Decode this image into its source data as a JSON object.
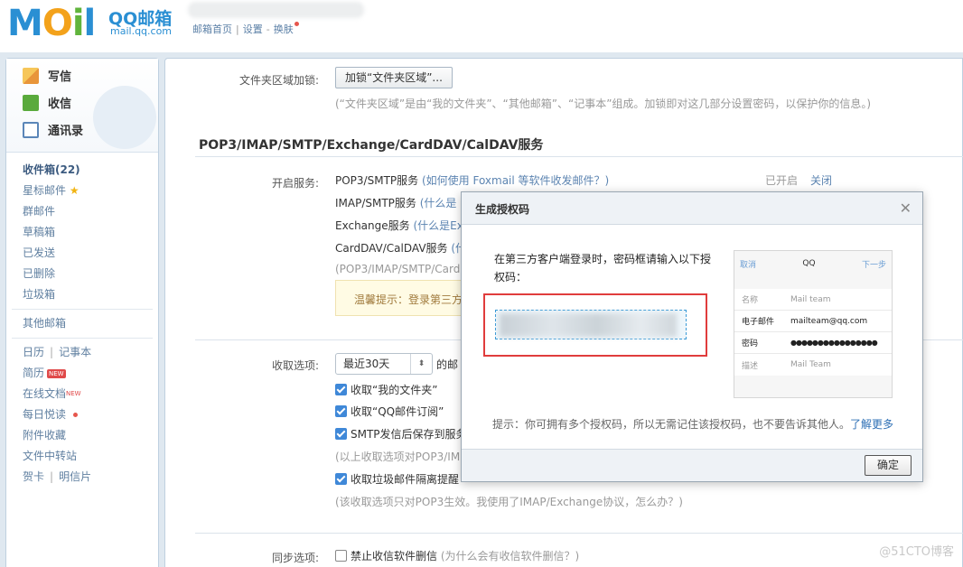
{
  "header": {
    "logo_text": "MOIL",
    "logo_name": "QQ邮箱",
    "logo_url": "mail.qq.com",
    "links": [
      "邮箱首页",
      "设置",
      "换肤"
    ]
  },
  "sidebar": {
    "actions": [
      {
        "label": "写信",
        "icon": "pen-icon"
      },
      {
        "label": "收信",
        "icon": "inbox-download-icon"
      },
      {
        "label": "通讯录",
        "icon": "contacts-icon"
      }
    ],
    "folders": {
      "inbox": "收件箱(22)",
      "starred": "星标邮件",
      "group": "群邮件",
      "drafts": "草稿箱",
      "sent": "已发送",
      "deleted": "已删除",
      "trash": "垃圾箱",
      "other": "其他邮箱",
      "calendar": "日历",
      "notes": "记事本",
      "resume": "简历",
      "resume_badge": "NEW",
      "docs": "在线文档",
      "docs_badge": "NEW",
      "daily": "每日悦读",
      "attach": "附件收藏",
      "transfer": "文件中转站",
      "cards": "贺卡",
      "postcard": "明信片"
    }
  },
  "main": {
    "folder_lock_label": "文件夹区域加锁:",
    "folder_lock_button": "加锁“文件夹区域”...",
    "folder_lock_hint": "(“文件夹区域”是由“我的文件夹”、“其他邮箱”、“记事本”组成。加锁即对这几部分设置密码，以保护你的信息。)",
    "section_title": "POP3/IMAP/SMTP/Exchange/CardDAV/CalDAV服务",
    "enable_label": "开启服务:",
    "services": [
      {
        "name": "POP3/SMTP服务",
        "help": "(如何使用 Foxmail 等软件收发邮件？)"
      },
      {
        "name": "IMAP/SMTP服务",
        "help": "(什么是"
      },
      {
        "name": "Exchange服务",
        "help": "(什么是Ex"
      },
      {
        "name": "CardDAV/CalDAV服务",
        "help": "(什"
      }
    ],
    "service_note": "(POP3/IMAP/SMTP/Card",
    "status_on": "已开启",
    "status_close": "关闭",
    "tip_text": "温馨提示：登录第三方",
    "receive_label": "收取选项:",
    "receive_range": "最近30天",
    "receive_suffix": "的邮",
    "options": [
      {
        "label": "收取“我的文件夹”",
        "checked": true
      },
      {
        "label": "收取“QQ邮件订阅”",
        "checked": true
      },
      {
        "label": "SMTP发信后保存到服务",
        "checked": true
      }
    ],
    "options_note": "(以上收取选项对POP3/IM",
    "junk_option": "收取垃圾邮件隔离提醒",
    "junk_note": "(该收取选项只对POP3生效。我使用了IMAP/Exchange协议，怎么办？)",
    "sync_label": "同步选项:",
    "sync_option": "禁止收信软件删信",
    "sync_help": "(为什么会有收信软件删信？)"
  },
  "modal": {
    "title": "生成授权码",
    "instruction": "在第三方客户端登录时，密码框请输入以下授权码：",
    "phone": {
      "cancel": "取消",
      "title": "QQ",
      "next": "下一步",
      "rows": [
        {
          "key": "名称",
          "value": "Mail team"
        },
        {
          "key": "电子邮件",
          "value": "mailteam@qq.com"
        },
        {
          "key": "密码",
          "value": "●●●●●●●●●●●●●●●●"
        },
        {
          "key": "描述",
          "value": "Mail Team"
        }
      ]
    },
    "tip": "提示：你可拥有多个授权码，所以无需记住该授权码，也不要告诉其他人。",
    "learn_more": "了解更多",
    "ok": "确定"
  },
  "watermark": "@51CTO博客"
}
